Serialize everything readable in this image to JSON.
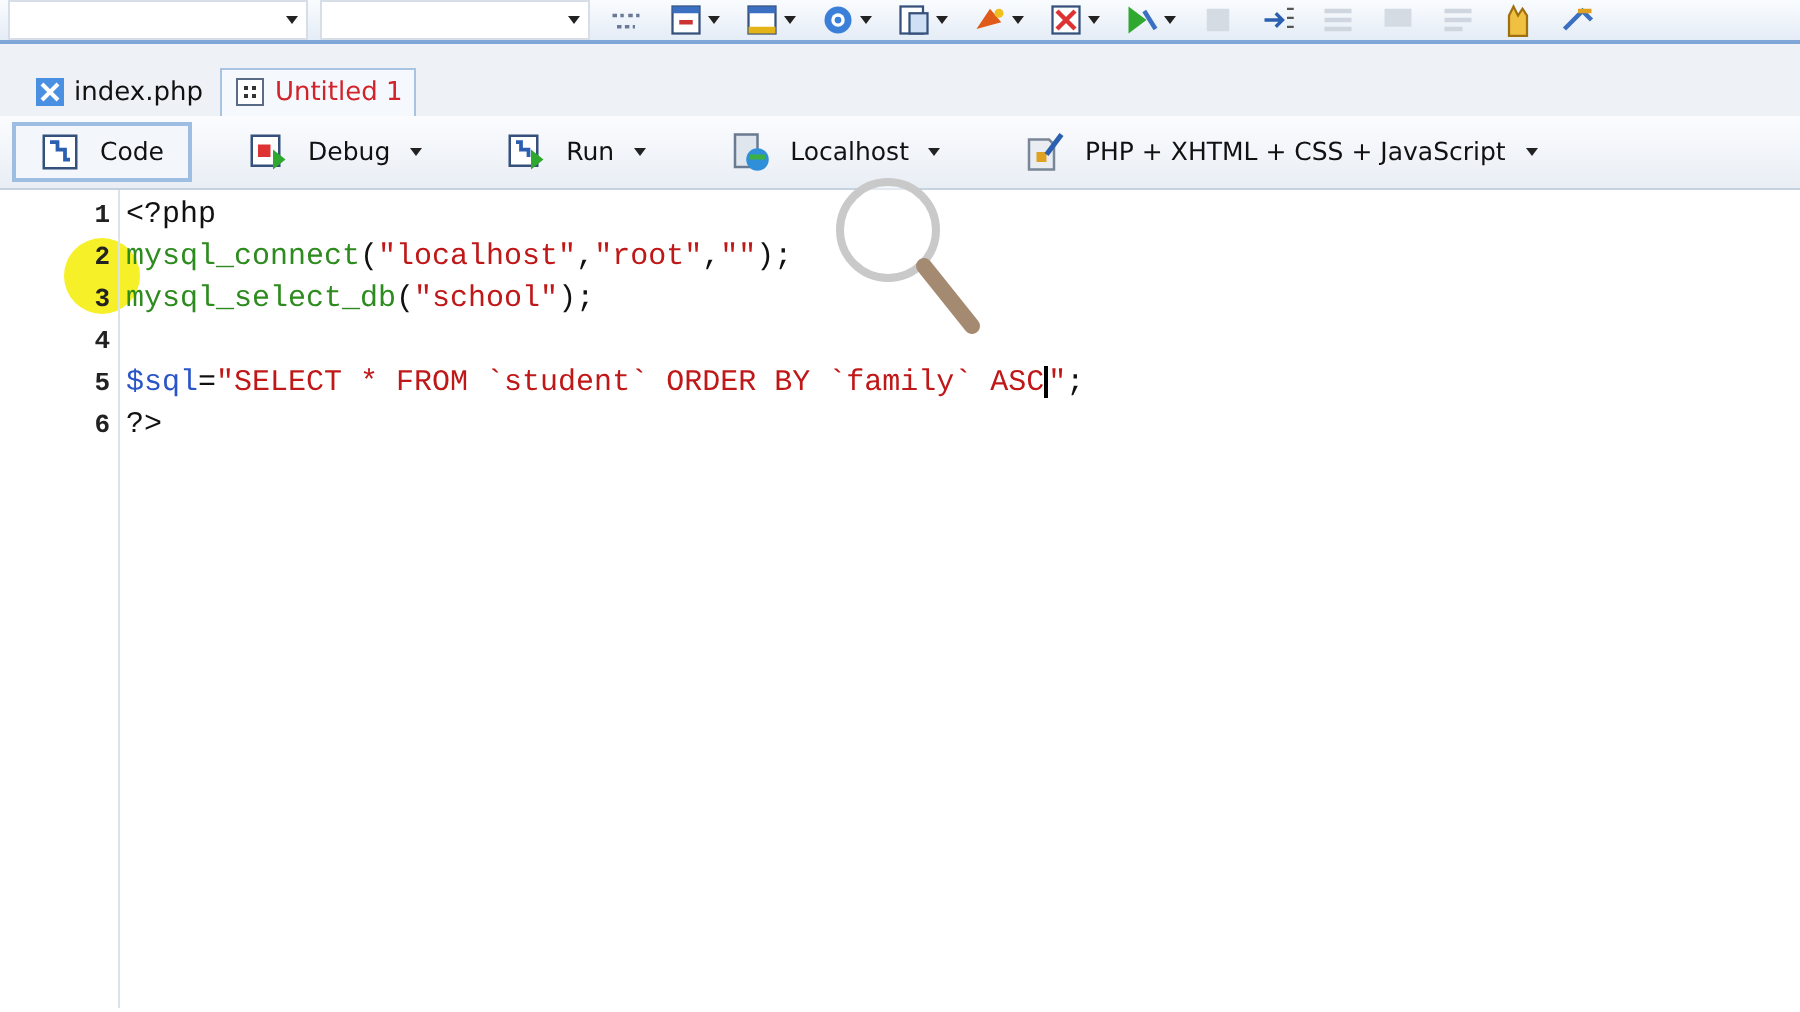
{
  "tabs": [
    {
      "label": "index.php",
      "selected": false
    },
    {
      "label": "Untitled 1",
      "selected": true
    }
  ],
  "toolbar": [
    {
      "label": "Code",
      "selected": true,
      "dropdown": false
    },
    {
      "label": "Debug",
      "selected": false,
      "dropdown": true
    },
    {
      "label": "Run",
      "selected": false,
      "dropdown": true
    },
    {
      "label": "Localhost",
      "selected": false,
      "dropdown": true
    },
    {
      "label": "PHP + XHTML + CSS + JavaScript",
      "selected": false,
      "dropdown": true
    }
  ],
  "editor": {
    "lines": [
      {
        "number": "1",
        "tokens": [
          {
            "kind": "plain",
            "text": "<?php"
          }
        ]
      },
      {
        "number": "2",
        "tokens": [
          {
            "kind": "func",
            "text": "mysql_connect"
          },
          {
            "kind": "plain",
            "text": "("
          },
          {
            "kind": "string",
            "text": "\"localhost\""
          },
          {
            "kind": "plain",
            "text": ","
          },
          {
            "kind": "string",
            "text": "\"root\""
          },
          {
            "kind": "plain",
            "text": ","
          },
          {
            "kind": "string",
            "text": "\"\""
          },
          {
            "kind": "plain",
            "text": ");"
          }
        ]
      },
      {
        "number": "3",
        "tokens": [
          {
            "kind": "func",
            "text": "mysql_select_db"
          },
          {
            "kind": "plain",
            "text": "("
          },
          {
            "kind": "string",
            "text": "\"school\""
          },
          {
            "kind": "plain",
            "text": ");"
          }
        ]
      },
      {
        "number": "4"
      },
      {
        "number": "5",
        "tokens": [
          {
            "kind": "var",
            "text": "$sql"
          },
          {
            "kind": "plain",
            "text": "="
          },
          {
            "kind": "string",
            "text": "\"SELECT * FROM `student` ORDER BY `family` ASC"
          },
          {
            "kind": "caret"
          },
          {
            "kind": "string",
            "text": "\""
          },
          {
            "kind": "plain",
            "text": ";"
          }
        ]
      },
      {
        "number": "6",
        "tokens": [
          {
            "kind": "plain",
            "text": "?>"
          }
        ]
      }
    ]
  }
}
